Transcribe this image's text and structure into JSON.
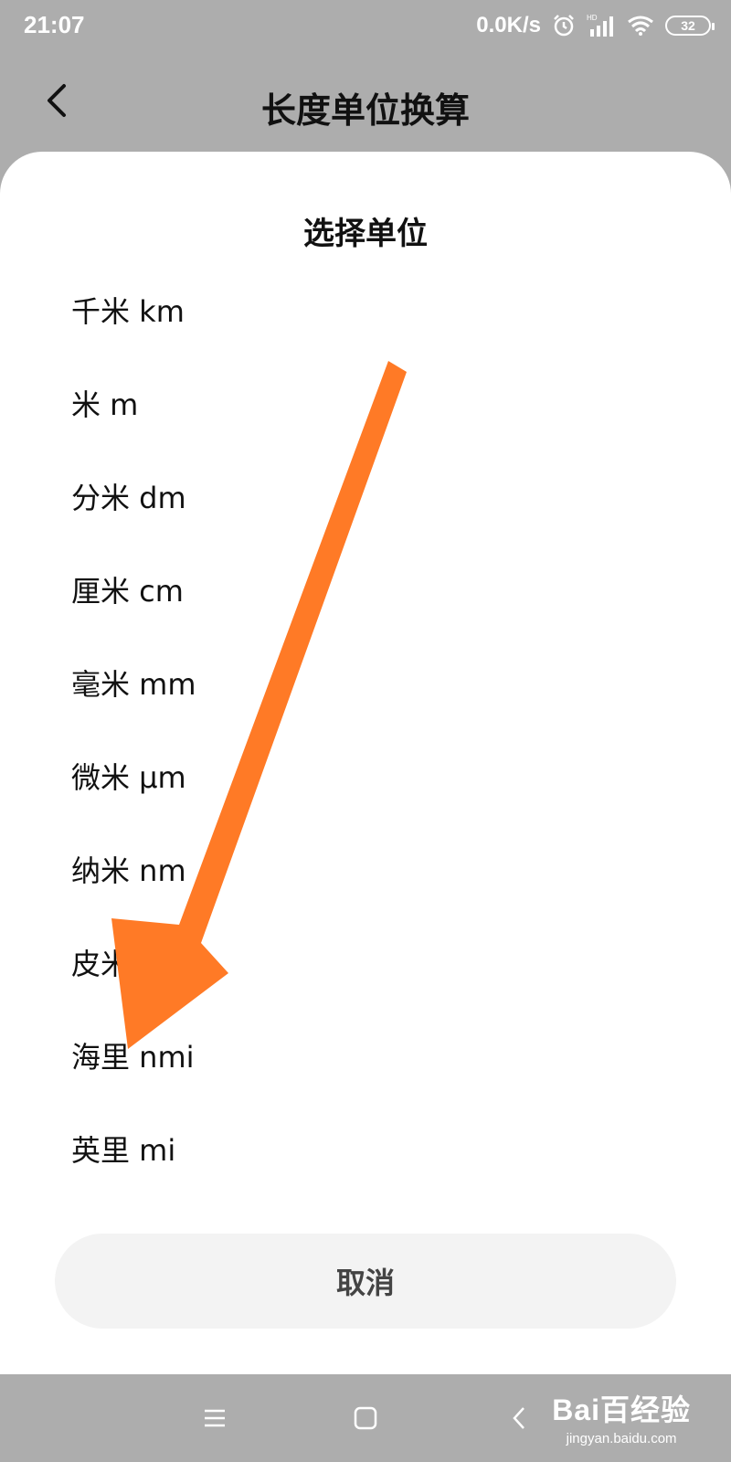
{
  "status_bar": {
    "time": "21:07",
    "network_speed": "0.0K/s",
    "hd_label": "HD",
    "battery": "32",
    "icons": [
      "alarm-icon",
      "signal-icon",
      "wifi-icon",
      "battery-icon"
    ]
  },
  "header": {
    "title": "长度单位换算",
    "back_icon": "back-arrow-icon"
  },
  "sheet": {
    "title": "选择单位",
    "units": [
      {
        "label": "千米 km"
      },
      {
        "label": "米 m"
      },
      {
        "label": "分米 dm"
      },
      {
        "label": "厘米 cm"
      },
      {
        "label": "毫米 mm"
      },
      {
        "label": "微米 μm"
      },
      {
        "label": "纳米 nm"
      },
      {
        "label": "皮米 pm"
      },
      {
        "label": "海里 nmi"
      },
      {
        "label": "英里 mi"
      }
    ],
    "cancel_label": "取消"
  },
  "annotation": {
    "color": "#ff7a26",
    "icon": "orange-arrow-annotation"
  },
  "nav_bar": {
    "icons": [
      "menu-icon",
      "home-square-icon",
      "back-chevron-icon"
    ]
  },
  "watermark": {
    "logo": "Bai百经验",
    "url": "jingyan.baidu.com"
  },
  "colors": {
    "overlay": "#adadad",
    "sheet": "#ffffff",
    "cancel_bg": "#f3f3f3"
  }
}
